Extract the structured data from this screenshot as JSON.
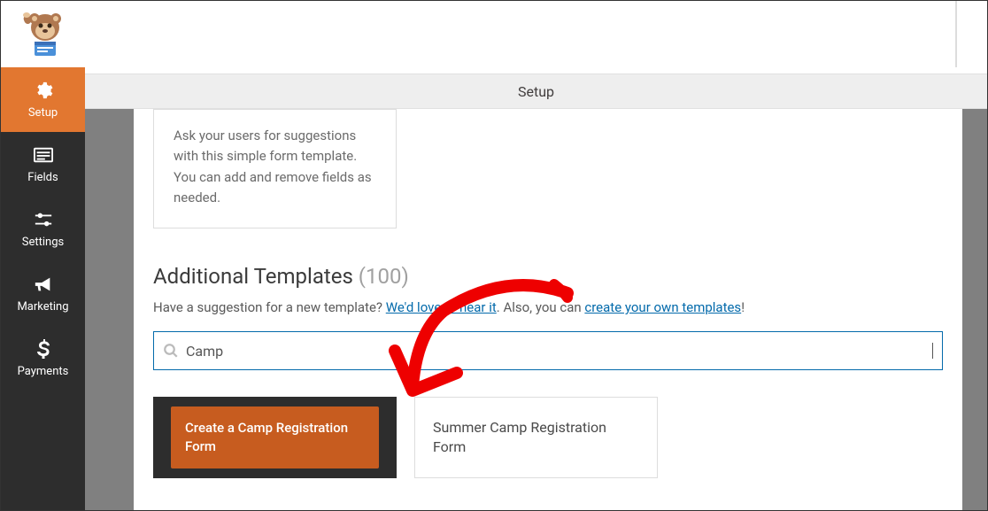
{
  "header": {
    "title": "Setup"
  },
  "sidebar": {
    "items": [
      {
        "label": "Setup",
        "icon": "gear"
      },
      {
        "label": "Fields",
        "icon": "list"
      },
      {
        "label": "Settings",
        "icon": "sliders"
      },
      {
        "label": "Marketing",
        "icon": "bullhorn"
      },
      {
        "label": "Payments",
        "icon": "dollar"
      }
    ]
  },
  "suggestionCard": {
    "text": "Ask your users for suggestions with this simple form template. You can add and remove fields as needed."
  },
  "additional": {
    "title": "Additional Templates",
    "count": "(100)",
    "subPrefix": "Have a suggestion for a new template? ",
    "link1": "We'd love to hear it",
    "subMid": ". Also, you can ",
    "link2": "create your own templates",
    "subEnd": "!"
  },
  "search": {
    "value": "Camp",
    "placeholder": "Search"
  },
  "results": {
    "primary": "Create a Camp Registration Form",
    "secondary": "Summer Camp Registration Form"
  }
}
